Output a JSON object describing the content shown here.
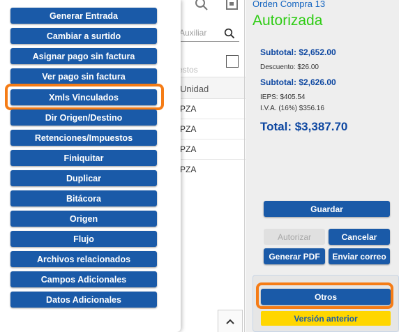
{
  "order": {
    "title": "Orden Compra 13",
    "status": "Autorizada",
    "status_color": "#2ecc14"
  },
  "middle": {
    "search_placeholder": "Auxiliar",
    "gasto_label": "estos",
    "column_header": "Unidad",
    "rows": [
      "PZA",
      "PZA",
      "PZA",
      "PZA"
    ]
  },
  "totals": {
    "subtotal1": "Subtotal: $2,652.00",
    "descuento": "Descuento: $26.00",
    "subtotal2": "Subtotal: $2,626.00",
    "ieps": "IEPS: $405.54",
    "iva": "I.V.A. (16%) $356.16",
    "total": "Total: $3,387.70"
  },
  "actions": {
    "guardar": "Guardar",
    "autorizar": "Autorizar",
    "cancelar": "Cancelar",
    "generar_pdf": "Generar PDF",
    "enviar_correo": "Enviar correo",
    "otros": "Otros",
    "version_anterior": "Versión anterior"
  },
  "menu": {
    "items": [
      "Generar Entrada",
      "Cambiar a surtido",
      "Asignar pago sin factura",
      "Ver pago sin factura",
      "Xmls Vinculados",
      "Dir Origen/Destino",
      "Retenciones/Impuestos",
      "Finiquitar",
      "Duplicar",
      "Bitácora",
      "Origen",
      "Flujo",
      "Archivos relacionados",
      "Campos Adicionales",
      "Datos Adicionales"
    ]
  },
  "colors": {
    "accent": "#1a5aa8",
    "highlight": "#f57c16",
    "version_bg": "#ffd600",
    "heading": "#0d47a1"
  },
  "icons": [
    "search-icon",
    "window-icon",
    "chevron-up-icon"
  ]
}
